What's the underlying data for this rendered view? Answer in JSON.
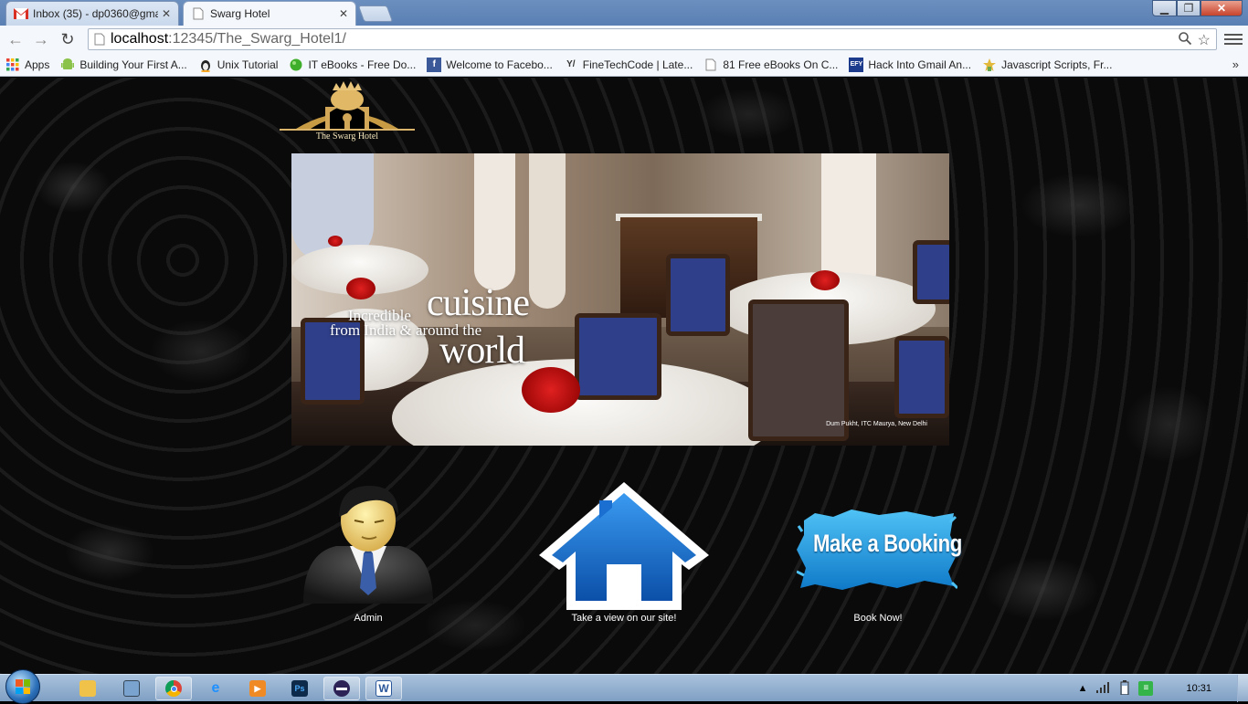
{
  "browser": {
    "tabs": [
      {
        "title": "Inbox (35) - dp0360@gma",
        "active": false
      },
      {
        "title": "Swarg Hotel",
        "active": true
      }
    ],
    "url_host": "localhost",
    "url_path": ":12345/The_Swarg_Hotel1/",
    "bookmarks": [
      {
        "label": "Apps",
        "icon": "apps-grid-icon"
      },
      {
        "label": "Building Your First A...",
        "icon": "android-icon"
      },
      {
        "label": "Unix Tutorial",
        "icon": "tux-icon"
      },
      {
        "label": "IT eBooks - Free Do...",
        "icon": "green-ball-icon"
      },
      {
        "label": "Welcome to Facebo...",
        "icon": "facebook-icon"
      },
      {
        "label": "FineTechCode | Late...",
        "icon": "yy-icon"
      },
      {
        "label": "81 Free eBooks On C...",
        "icon": "page-icon"
      },
      {
        "label": "Hack Into Gmail An...",
        "icon": "efy-icon"
      },
      {
        "label": "Javascript Scripts, Fr...",
        "icon": "star-wizard-icon"
      }
    ]
  },
  "page": {
    "logo_text": "The Swarg Hotel",
    "banner": {
      "line1": "Incredible",
      "word1": "cuisine",
      "line2": "from India & around the",
      "word2": "world",
      "caption": "Dum Pukht, ITC Maurya, New Delhi"
    },
    "actions": [
      {
        "label": "Admin",
        "icon": "admin-user-icon"
      },
      {
        "label": "Take a view on our site!",
        "icon": "home-icon"
      },
      {
        "label": "Book Now!",
        "icon": "make-a-booking-banner",
        "button_text": "Make a Booking"
      }
    ]
  },
  "taskbar": {
    "clock": "10:31"
  },
  "colors": {
    "home_blue": "#1a6fd0",
    "booking_blue": "#1a8fd8",
    "page_bg": "#0b0b0b"
  }
}
